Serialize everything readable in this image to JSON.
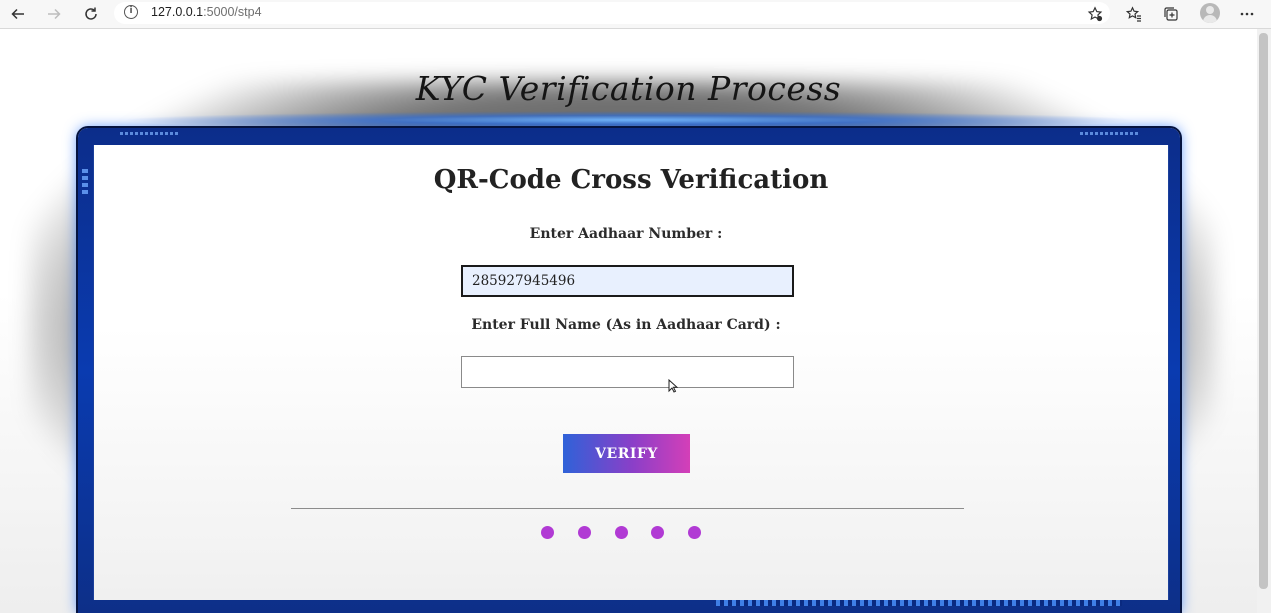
{
  "browser": {
    "url_host": "127.0.0.1",
    "url_rest": ":5000/stp4",
    "icons": [
      "back-icon",
      "forward-icon",
      "refresh-icon",
      "info-icon",
      "favorite-add-icon",
      "favorites-icon",
      "collections-icon",
      "profile-icon",
      "more-icon"
    ]
  },
  "page": {
    "site_title": "KYC Verification Process",
    "card_title": "QR-Code Cross Verification",
    "aadhaar_label": "Enter Aadhaar Number :",
    "aadhaar_value": "285927945496",
    "name_label": "Enter Full Name (As in Aadhaar Card) :",
    "name_value": "",
    "verify_label": "VERIFY",
    "step_dots": 5,
    "colors": {
      "frame": "#0a3bb0",
      "dot": "#b13ad4",
      "button_start": "#2f62d8",
      "button_end": "#d43fb8"
    }
  }
}
